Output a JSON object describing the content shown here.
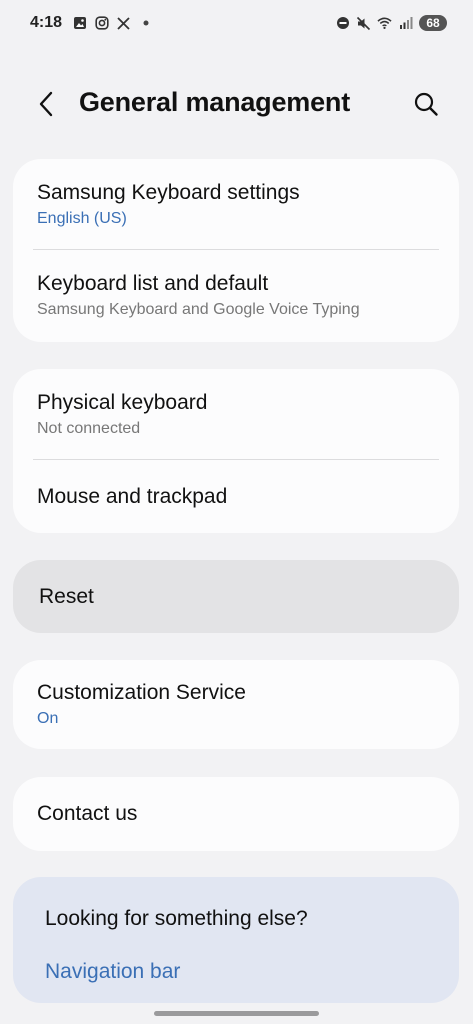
{
  "status_bar": {
    "time": "4:18",
    "battery": "68",
    "left_icons": [
      "gallery-icon",
      "instagram-icon",
      "x-icon",
      "dot-icon"
    ],
    "right_icons": [
      "dnd-icon",
      "mute-icon",
      "wifi-icon",
      "signal-icon"
    ]
  },
  "header": {
    "title": "General management",
    "back_icon": "chevron-left-icon",
    "search_icon": "search-icon"
  },
  "groups": {
    "keyboard": {
      "items": [
        {
          "title": "Samsung Keyboard settings",
          "subtitle": "English (US)"
        },
        {
          "title": "Keyboard list and default",
          "subtitle": "Samsung Keyboard and Google Voice Typing"
        }
      ]
    },
    "input": {
      "items": [
        {
          "title": "Physical keyboard",
          "subtitle": "Not connected"
        },
        {
          "title": "Mouse and trackpad"
        }
      ]
    },
    "reset": {
      "title": "Reset"
    },
    "customization": {
      "title": "Customization Service",
      "subtitle": "On"
    },
    "contact": {
      "title": "Contact us"
    },
    "looking": {
      "title": "Looking for something else?",
      "link": "Navigation bar"
    }
  },
  "colors": {
    "background": "#f2f2f4",
    "card": "#fcfcfd",
    "accent_blue": "#3a6fb5",
    "reset_highlight": "#e3e3e5",
    "looking_card": "#e1e6f2"
  }
}
